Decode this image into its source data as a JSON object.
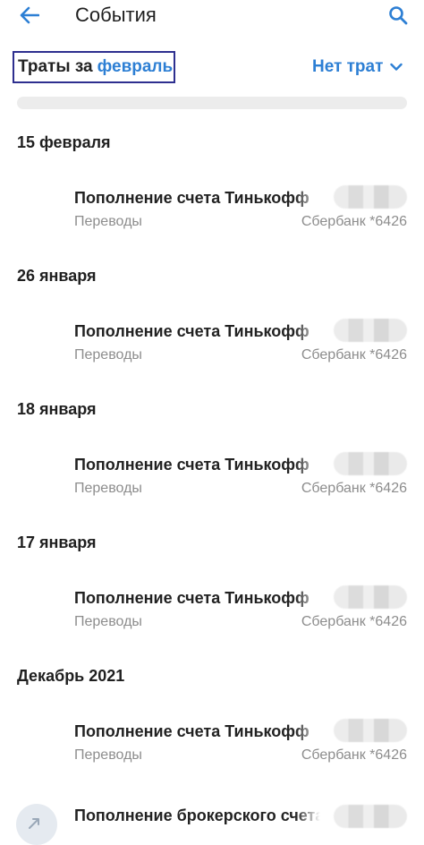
{
  "header": {
    "title": "События"
  },
  "filter": {
    "prefix": "Траты за",
    "month": "февраль",
    "no_spend_label": "Нет трат"
  },
  "groups": [
    {
      "title": "15 февраля",
      "tx": {
        "title": "Пополнение счета Тинькофф",
        "category": "Переводы",
        "account": "Сбербанк *6426"
      }
    },
    {
      "title": "26 января",
      "tx": {
        "title": "Пополнение счета Тинькофф",
        "category": "Переводы",
        "account": "Сбербанк *6426"
      }
    },
    {
      "title": "18 января",
      "tx": {
        "title": "Пополнение счета Тинькофф",
        "category": "Переводы",
        "account": "Сбербанк *6426"
      }
    },
    {
      "title": "17 января",
      "tx": {
        "title": "Пополнение счета Тинькофф",
        "category": "Переводы",
        "account": "Сбербанк *6426"
      }
    },
    {
      "title": "Декабрь 2021",
      "tx": {
        "title": "Пополнение счета Тинькофф",
        "category": "Переводы",
        "account": "Сбербанк *6426"
      }
    }
  ],
  "extra_tx": {
    "title": "Пополнение брокерского счета"
  }
}
